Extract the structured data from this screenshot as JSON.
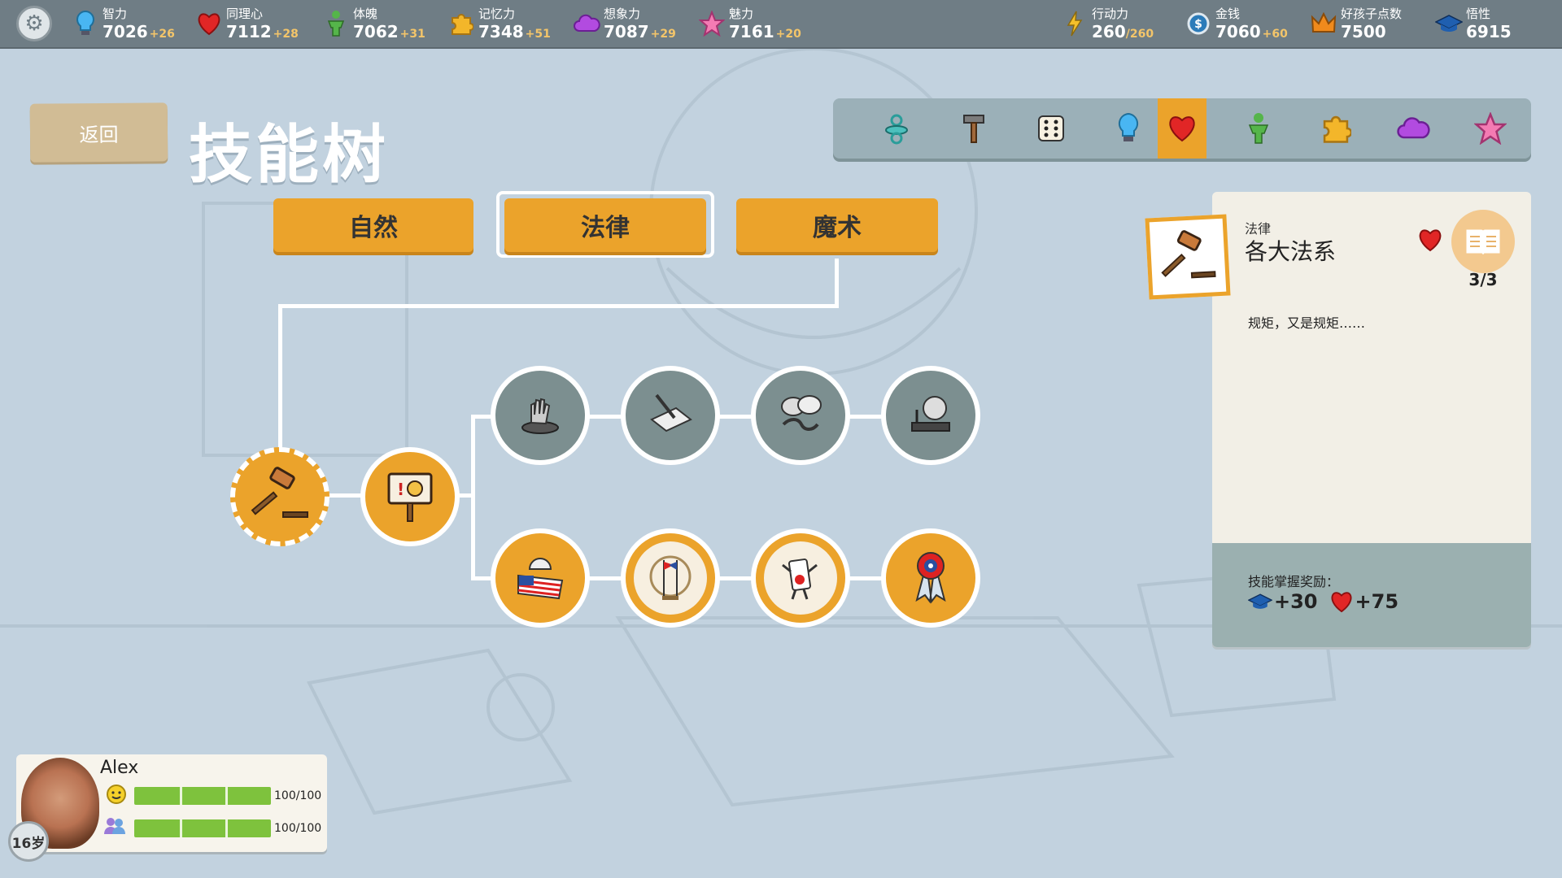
{
  "top_stats": [
    {
      "id": "intelligence",
      "label": "智力",
      "value": "7026",
      "inc": "+26",
      "icon": "lightbulb-icon"
    },
    {
      "id": "empathy",
      "label": "同理心",
      "value": "7112",
      "inc": "+28",
      "icon": "heart-icon"
    },
    {
      "id": "physique",
      "label": "体魄",
      "value": "7062",
      "inc": "+31",
      "icon": "person-icon"
    },
    {
      "id": "memory",
      "label": "记忆力",
      "value": "7348",
      "inc": "+51",
      "icon": "puzzle-icon"
    },
    {
      "id": "imagination",
      "label": "想象力",
      "value": "7087",
      "inc": "+29",
      "icon": "cloud-icon"
    },
    {
      "id": "charm",
      "label": "魅力",
      "value": "7161",
      "inc": "+20",
      "icon": "star-icon"
    },
    {
      "id": "energy",
      "label": "行动力",
      "value": "260",
      "max": "/260",
      "icon": "lightning-icon"
    },
    {
      "id": "money",
      "label": "金钱",
      "value": "7060",
      "inc": "+60",
      "icon": "coin-icon"
    },
    {
      "id": "good_kid",
      "label": "好孩子点数",
      "value": "7500",
      "icon": "crown-icon"
    },
    {
      "id": "insight",
      "label": "悟性",
      "value": "6915",
      "icon": "graduation-cap-icon"
    }
  ],
  "header": {
    "back_label": "返回",
    "title": "技能树"
  },
  "categories": [
    {
      "icon": "pacifier-icon"
    },
    {
      "icon": "hammer-icon"
    },
    {
      "icon": "dice-icon"
    },
    {
      "icon": "lightbulb-icon"
    },
    {
      "icon": "heart-icon",
      "active": true
    },
    {
      "icon": "person-icon"
    },
    {
      "icon": "puzzle-icon"
    },
    {
      "icon": "cloud-icon"
    },
    {
      "icon": "star-icon"
    }
  ],
  "tabs": [
    {
      "label": "自然"
    },
    {
      "label": "法律",
      "selected": true
    },
    {
      "label": "魔术"
    }
  ],
  "tree_nodes": [
    {
      "icon": "gavel-icon",
      "state": "selected"
    },
    {
      "icon": "protest-sign-icon",
      "state": "unlocked"
    },
    {
      "icon": "hand-on-button-icon",
      "state": "locked"
    },
    {
      "icon": "pen-and-paper-icon",
      "state": "locked"
    },
    {
      "icon": "handshake-icon",
      "state": "locked"
    },
    {
      "icon": "speaker-podium-icon",
      "state": "locked"
    },
    {
      "icon": "us-flag-capitol-icon",
      "state": "unlocked"
    },
    {
      "icon": "flags-globe-icon",
      "state": "unlocked"
    },
    {
      "icon": "ballot-character-icon",
      "state": "unlocked"
    },
    {
      "icon": "award-ribbon-icon",
      "state": "unlocked"
    }
  ],
  "detail": {
    "category": "法律",
    "name": "各大法系",
    "progress": "3/3",
    "description": "规矩，又是规矩……",
    "reward_label": "技能掌握奖励：",
    "rewards": [
      {
        "icon": "graduation-cap-icon",
        "value": "+30"
      },
      {
        "icon": "heart-icon",
        "value": "+75"
      }
    ]
  },
  "player": {
    "name": "Alex",
    "age": "16岁",
    "happiness": {
      "value": "100/100",
      "fraction": 1.0
    },
    "social": {
      "value": "100/100",
      "fraction": 1.0
    }
  },
  "colors": {
    "accent": "#eba32b",
    "background": "#c2d2df",
    "topbar": "#6f7d85",
    "locked": "#7c8f90"
  }
}
